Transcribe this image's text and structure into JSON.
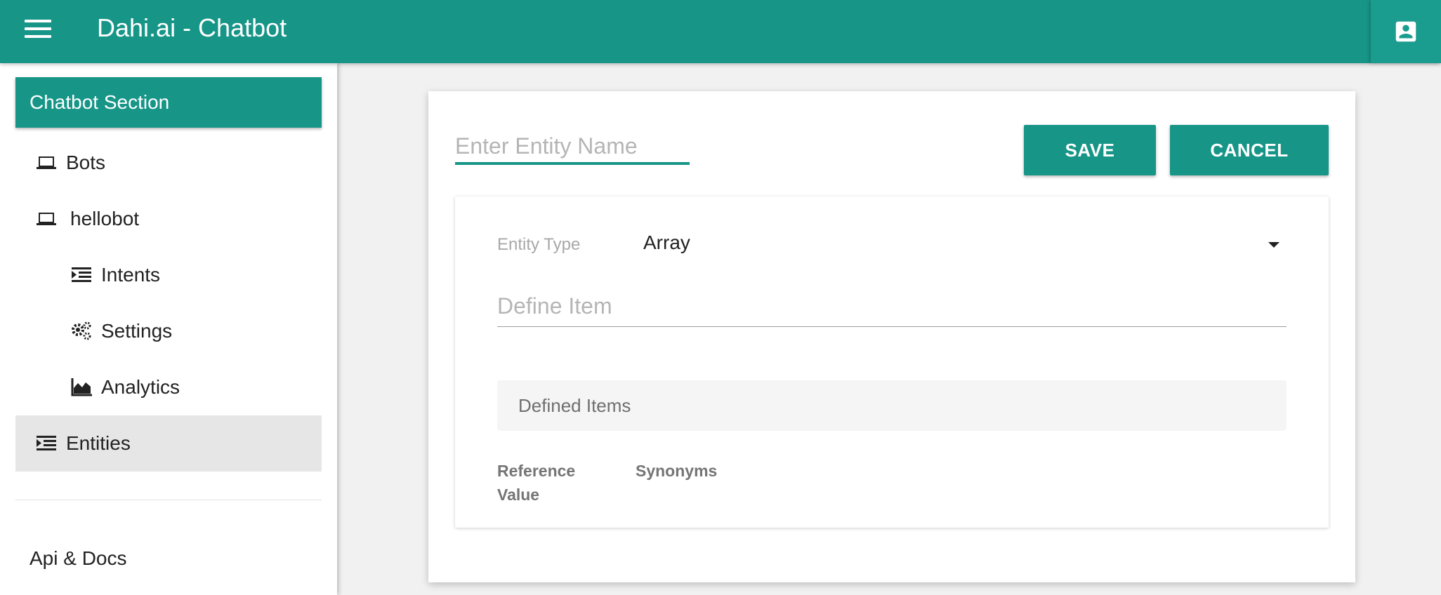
{
  "header": {
    "title": "Dahi.ai - Chatbot",
    "menu_icon": "hamburger-menu-icon",
    "account_icon": "account-box-icon",
    "color": "#179688"
  },
  "sidebar": {
    "section_title": "Chatbot Section",
    "items": [
      {
        "label": "Bots",
        "icon": "laptop-icon",
        "active": false
      },
      {
        "label": "hellobot",
        "icon": "laptop-icon",
        "active": false
      },
      {
        "label": "Intents",
        "icon": "format-indent-icon",
        "active": false
      },
      {
        "label": "Settings",
        "icon": "gears-icon",
        "active": false
      },
      {
        "label": "Analytics",
        "icon": "area-chart-icon",
        "active": false
      },
      {
        "label": "Entities",
        "icon": "format-indent-icon",
        "active": true
      }
    ],
    "footer_link": "Api & Docs"
  },
  "form": {
    "entity_name_value": "",
    "entity_name_placeholder": "Enter Entity Name",
    "save_label": "SAVE",
    "cancel_label": "CANCEL",
    "entity_type_label": "Entity Type",
    "entity_type_value": "Array",
    "define_item_placeholder": "Define Item",
    "defined_items_label": "Defined Items",
    "table_headers": [
      "Reference Value",
      "Synonyms"
    ]
  }
}
